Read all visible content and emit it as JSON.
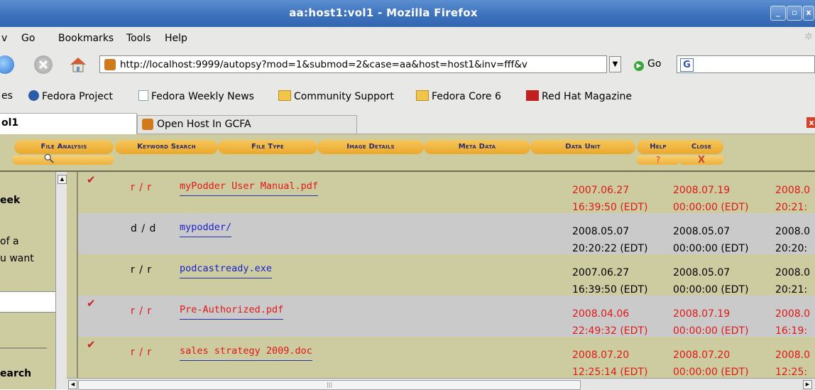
{
  "window": {
    "title": "aa:host1:vol1 - Mozilla Firefox"
  },
  "menu": {
    "items": [
      "v",
      "Go",
      "Bookmarks",
      "Tools",
      "Help"
    ]
  },
  "nav": {
    "url": "http://localhost:9999/autopsy?mod=1&submod=2&case=aa&host=host1&inv=fff&v",
    "go_label": "Go",
    "search_value": ""
  },
  "bookmarks": {
    "partial": "es",
    "items": [
      "Fedora Project",
      "Fedora Weekly News",
      "Community Support",
      "Fedora Core 6",
      "Red Hat Magazine"
    ]
  },
  "tabs": [
    {
      "label": "ol1",
      "active": true
    },
    {
      "label": "Open Host In GCFA",
      "active": false
    }
  ],
  "autopsy": {
    "buttons": [
      "File Analysis",
      "Keyword Search",
      "File Type",
      "Image Details",
      "Meta Data",
      "Data Unit",
      "Help",
      "Close"
    ],
    "help_symbol": "?",
    "close_symbol": "X"
  },
  "left_panel": {
    "lines": [
      "eek",
      "of a",
      "u want",
      "earch"
    ]
  },
  "files": [
    {
      "deleted": true,
      "type": "r / r",
      "name": "myPodder User Manual.pdf",
      "written": "2007.06.27",
      "written_time": "16:39:50 (EDT)",
      "accessed": "2008.07.19",
      "accessed_time": "00:00:00 (EDT)",
      "changed": "2008.0",
      "changed_time": "20:21:",
      "row_color": "olive"
    },
    {
      "deleted": false,
      "type": "d / d",
      "name": "mypodder/",
      "written": "2008.05.07",
      "written_time": "20:20:22 (EDT)",
      "accessed": "2008.05.07",
      "accessed_time": "00:00:00 (EDT)",
      "changed": "2008.0",
      "changed_time": "20:20:",
      "row_color": "grey"
    },
    {
      "deleted": false,
      "type": "r / r",
      "name": "podcastready.exe",
      "written": "2007.06.27",
      "written_time": "16:39:50 (EDT)",
      "accessed": "2008.05.07",
      "accessed_time": "00:00:00 (EDT)",
      "changed": "2008.0",
      "changed_time": "20:21:",
      "row_color": "olive"
    },
    {
      "deleted": true,
      "type": "r / r",
      "name": "Pre-Authorized.pdf",
      "written": "2008.04.06",
      "written_time": "22:49:32 (EDT)",
      "accessed": "2008.07.19",
      "accessed_time": "00:00:00 (EDT)",
      "changed": "2008.0",
      "changed_time": "16:19:",
      "row_color": "grey"
    },
    {
      "deleted": true,
      "type": "r / r",
      "name": "sales strategy 2009.doc",
      "written": "2008.07.20",
      "written_time": "12:25:14 (EDT)",
      "accessed": "2008.07.20",
      "accessed_time": "00:00:00 (EDT)",
      "changed": "2008.0",
      "changed_time": "12:25:",
      "row_color": "olive"
    }
  ],
  "colors": {
    "deleted_text": "#e01818",
    "allocated_link": "#1a22cc",
    "row_olive": "#cdcba0",
    "row_grey": "#cacaca"
  }
}
